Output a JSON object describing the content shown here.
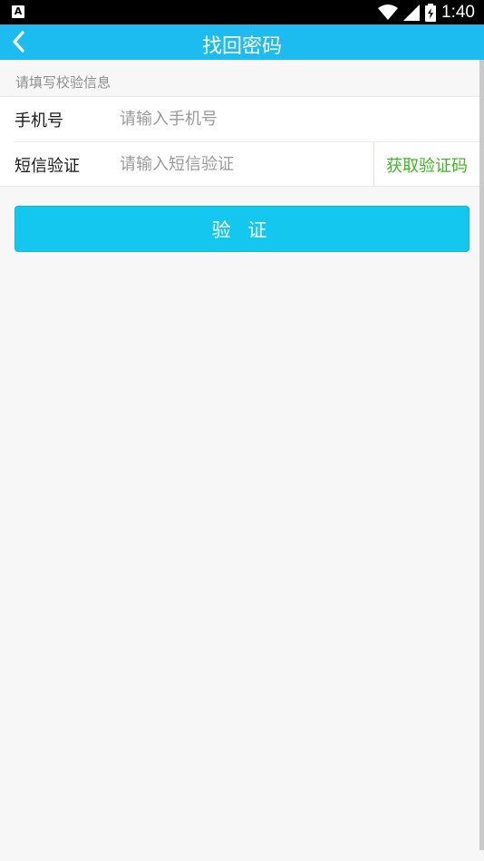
{
  "status_bar": {
    "time": "1:40",
    "app_icon_letter": "A",
    "icons": [
      "wifi-icon",
      "signal-icon",
      "battery-icon"
    ]
  },
  "app_bar": {
    "title": "找回密码",
    "back_icon": "chevron-left-icon",
    "background_color": "#1cbcf0"
  },
  "form": {
    "hint": "请填写校验信息",
    "phone": {
      "label": "手机号",
      "placeholder": "请输入手机号",
      "value": ""
    },
    "sms": {
      "label": "短信验证",
      "placeholder": "请输入短信验证",
      "value": "",
      "get_code_label": "获取验证码"
    }
  },
  "verify_button": {
    "label": "验 证",
    "color": "#14c7ee"
  }
}
